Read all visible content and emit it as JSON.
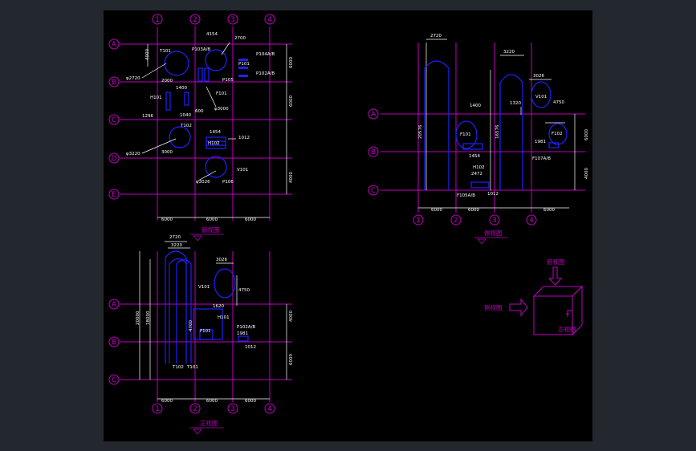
{
  "colors": {
    "background": "#000000",
    "frame": "#23272e",
    "gridline": "#c000c0",
    "equipment": "#2020ff",
    "text": "#ffffff",
    "axis_label": "#c000c0",
    "view_label": "#c000c0"
  },
  "axis_labels": {
    "columns": [
      "1",
      "2",
      "3",
      "4"
    ],
    "rows_plan": [
      "A",
      "B",
      "C",
      "D",
      "E"
    ],
    "rows_elev": [
      "A",
      "B",
      "C"
    ]
  },
  "plan_view": {
    "title": "俯视图",
    "spans": [
      "6000",
      "6000",
      "6000"
    ],
    "row_dims": [
      "4000",
      "6000",
      "6000",
      "4000"
    ],
    "tags": [
      "T101",
      "P103A/B",
      "P104A/B",
      "P102A/B",
      "P101",
      "P105",
      "F101",
      "H101",
      "H102",
      "T102",
      "V101",
      "P106",
      "φ2720",
      "φ3220",
      "φ3026",
      "φ3000",
      "2000",
      "1400",
      "1296",
      "1454",
      "1012",
      "1040",
      "600",
      "4154",
      "2700",
      "3000"
    ]
  },
  "side_view": {
    "title": "侧视图",
    "spans": [
      "6000",
      "6000",
      "6000"
    ],
    "tags": [
      "2720",
      "3220",
      "3026",
      "4750",
      "1320",
      "F101",
      "V101",
      "H102",
      "F102",
      "1454",
      "F105A/B",
      "F107A/B",
      "1012",
      "1981",
      "20576",
      "16576",
      "4000",
      "6000",
      "2472",
      "1400"
    ]
  },
  "front_view": {
    "title": "正视图",
    "spans": [
      "6000",
      "6000",
      "6000"
    ],
    "tags": [
      "2720",
      "3220",
      "3026",
      "V101",
      "4750",
      "1620",
      "H101",
      "F101",
      "P102A/B",
      "1981",
      "1012",
      "T102",
      "T101",
      "4700",
      "20000",
      "18000",
      "4000",
      "6000"
    ]
  },
  "projection": {
    "top_label": "俯视图",
    "side_label": "侧视图",
    "front_label": "正视图"
  }
}
